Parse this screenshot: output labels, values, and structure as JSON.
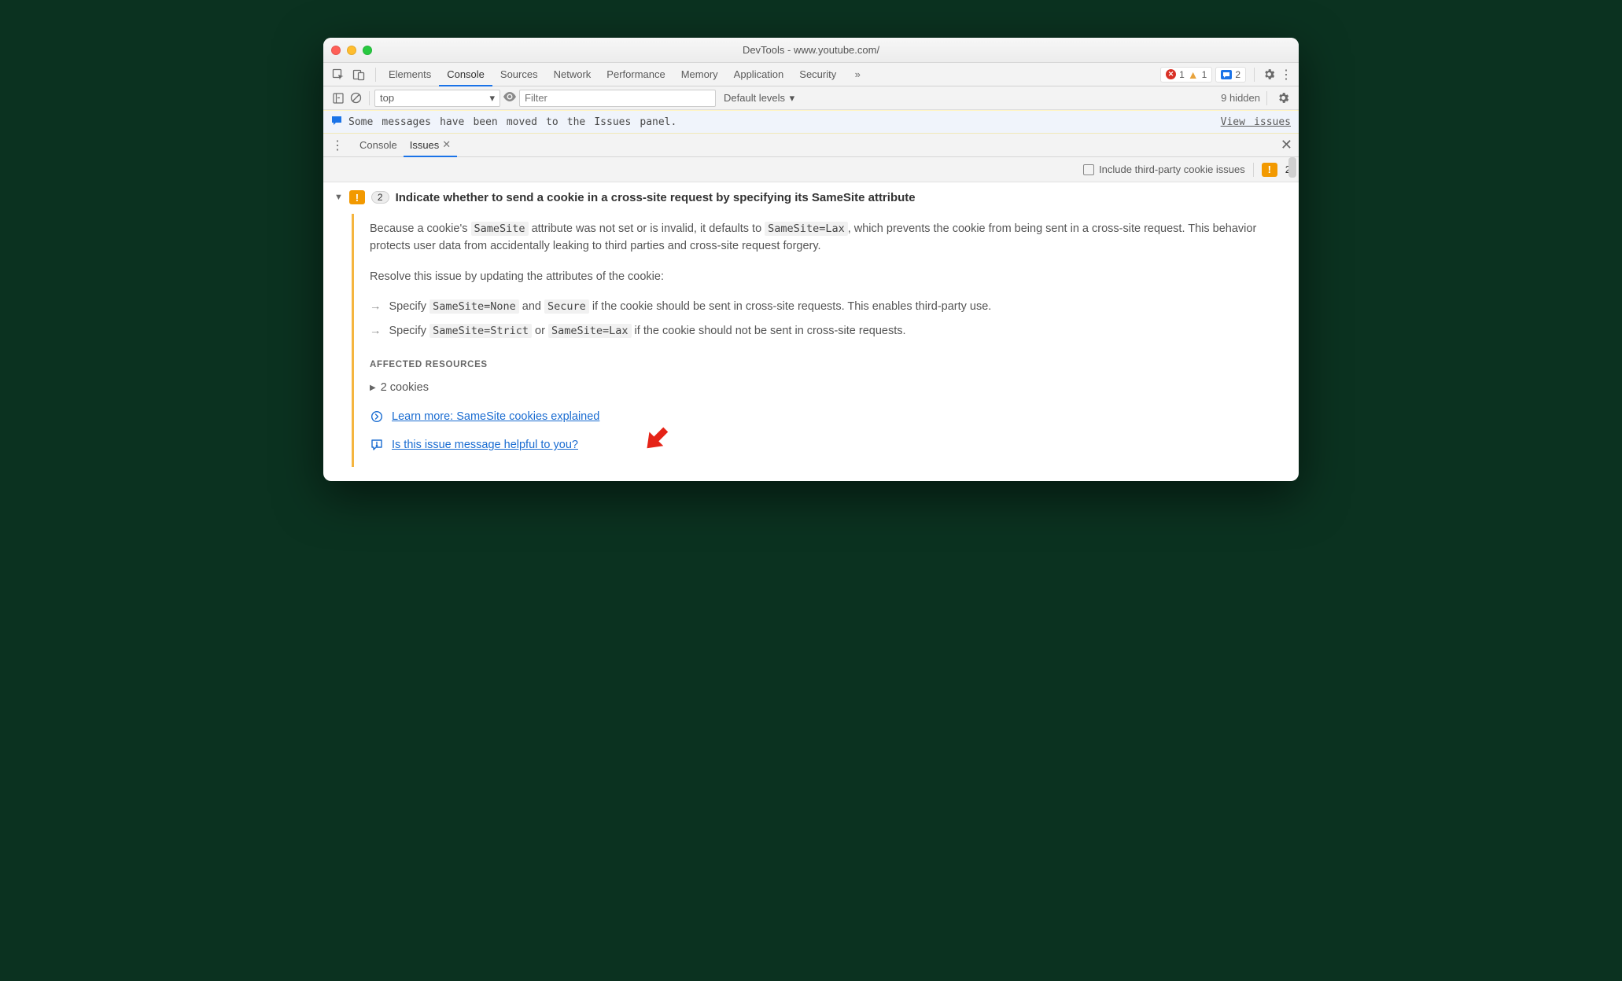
{
  "window": {
    "title": "DevTools - www.youtube.com/"
  },
  "main_tabs": [
    "Elements",
    "Console",
    "Sources",
    "Network",
    "Performance",
    "Memory",
    "Application",
    "Security"
  ],
  "active_main_tab": "Console",
  "top_badges": {
    "error_count": "1",
    "warn_count": "1",
    "msg_count": "2"
  },
  "filterbar": {
    "context": "top",
    "filter_placeholder": "Filter",
    "levels": "Default levels",
    "hidden": "9 hidden"
  },
  "notice": {
    "text": "Some messages have been moved to the Issues panel.",
    "view": "View issues"
  },
  "drawer_tabs": {
    "console": "Console",
    "issues": "Issues"
  },
  "issues_toolbar": {
    "checkbox_label": "Include third-party cookie issues",
    "badge_glyph": "!",
    "badge_count": "2"
  },
  "issue": {
    "count": "2",
    "title": "Indicate whether to send a cookie in a cross-site request by specifying its SameSite attribute",
    "p1a": "Because a cookie's ",
    "p1_code1": "SameSite",
    "p1b": " attribute was not set or is invalid, it defaults to ",
    "p1_code2": "SameSite=Lax",
    "p1c": ", which prevents the cookie from being sent in a cross-site request. This behavior protects user data from accidentally leaking to third parties and cross-site request forgery.",
    "p2": "Resolve this issue by updating the attributes of the cookie:",
    "b1a": "Specify ",
    "b1_code1": "SameSite=None",
    "b1b": " and ",
    "b1_code2": "Secure",
    "b1c": " if the cookie should be sent in cross-site requests. This enables third-party use.",
    "b2a": "Specify ",
    "b2_code1": "SameSite=Strict",
    "b2b": " or ",
    "b2_code2": "SameSite=Lax",
    "b2c": " if the cookie should not be sent in cross-site requests.",
    "affected_heading": "AFFECTED RESOURCES",
    "affected_row": "2 cookies",
    "learn_more": "Learn more: SameSite cookies explained",
    "survey": "Is this issue message helpful to you?"
  }
}
